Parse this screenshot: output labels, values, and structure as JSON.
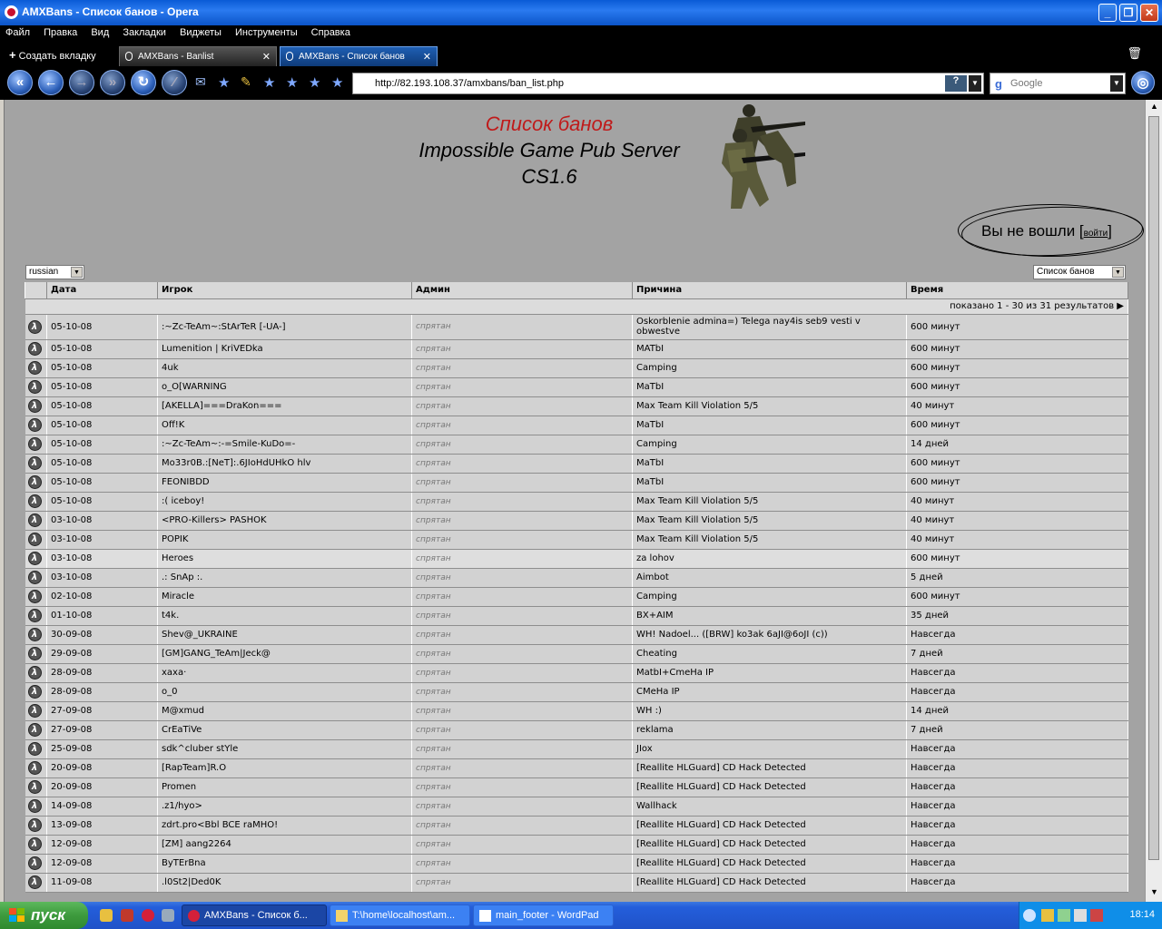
{
  "window": {
    "title": "AMXBans - Список банов - Opera"
  },
  "menu": [
    "Файл",
    "Правка",
    "Вид",
    "Закладки",
    "Виджеты",
    "Инструменты",
    "Справка"
  ],
  "tabs": {
    "new_tab": "Создать вкладку",
    "items": [
      {
        "label": "AMXBans - Banlist",
        "active": false
      },
      {
        "label": "AMXBans - Список банов",
        "active": true
      }
    ]
  },
  "nav": {
    "url": "http://82.193.108.37/amxbans/ban_list.php",
    "search_placeholder": "Google"
  },
  "page": {
    "title_red": "Список банов",
    "title_line2": "Impossible Game Pub Server",
    "title_line3": "CS1.6",
    "login_text": "Вы не вошли",
    "login_link": "войти",
    "language": "russian",
    "view_select": "Список банов",
    "columns": [
      "Дата",
      "Игрок",
      "Админ",
      "Причина",
      "Время"
    ],
    "pager": "показано 1 - 30 из 31 результатов",
    "admin_hidden": "спрятан",
    "rows": [
      {
        "date": "05-10-08",
        "player": ":~Zc-TeAm~:StArTeR [-UA-]",
        "reason": "Oskorblenie admina=) Telega nay4is seb9 vesti v obwestve",
        "time": "600 минут"
      },
      {
        "date": "05-10-08",
        "player": "Lumenition | KriVEDka",
        "reason": "MATbI",
        "time": "600 минут"
      },
      {
        "date": "05-10-08",
        "player": "4uk",
        "reason": "Camping",
        "time": "600 минут"
      },
      {
        "date": "05-10-08",
        "player": "o_O[WARNING",
        "reason": "MaTbI",
        "time": "600 минут"
      },
      {
        "date": "05-10-08",
        "player": "[AKELLA]===DraKon===",
        "reason": "Max Team Kill Violation 5/5",
        "time": "40 минут"
      },
      {
        "date": "05-10-08",
        "player": "Off!K",
        "reason": "MaTbI",
        "time": "600 минут"
      },
      {
        "date": "05-10-08",
        "player": ":~Zc-TeAm~:-=Smile-KuDo=-",
        "reason": "Camping",
        "time": "14 дней"
      },
      {
        "date": "05-10-08",
        "player": "Mo33r0B.:[NeT]:.6JIoHdUHkO hlv",
        "reason": "MaTbI",
        "time": "600 минут"
      },
      {
        "date": "05-10-08",
        "player": "FEONIBDD",
        "reason": "MaTbI",
        "time": "600 минут"
      },
      {
        "date": "05-10-08",
        "player": ":( iceboy!",
        "reason": "Max Team Kill Violation 5/5",
        "time": "40 минут"
      },
      {
        "date": "03-10-08",
        "player": "<PRO-Killers> PASHOK",
        "reason": "Max Team Kill Violation 5/5",
        "time": "40 минут"
      },
      {
        "date": "03-10-08",
        "player": "POPIK",
        "reason": "Max Team Kill Violation 5/5",
        "time": "40 минут"
      },
      {
        "date": "03-10-08",
        "player": "Heroes",
        "reason": "za lohov",
        "time": "600 минут"
      },
      {
        "date": "03-10-08",
        "player": ".: SnAp :.",
        "reason": "Aimbot",
        "time": "5 дней"
      },
      {
        "date": "02-10-08",
        "player": "Miracle",
        "reason": "Camping",
        "time": "600 минут"
      },
      {
        "date": "01-10-08",
        "player": "t4k.",
        "reason": "BX+AIM",
        "time": "35 дней"
      },
      {
        "date": "30-09-08",
        "player": "Shev@_UKRAINE",
        "reason": "WH! Nadoel... ([BRW] ko3ak 6aJI@6oJI (c))",
        "time": "Навсегда"
      },
      {
        "date": "29-09-08",
        "player": "[GM]GANG_TeAm|Jeck@",
        "reason": "Cheating",
        "time": "7 дней"
      },
      {
        "date": "28-09-08",
        "player": "xaxa·",
        "reason": "MatbI+CmeHa IP",
        "time": "Навсегда"
      },
      {
        "date": "28-09-08",
        "player": "o_0",
        "reason": "CMeHa IP",
        "time": "Навсегда"
      },
      {
        "date": "27-09-08",
        "player": "M@xmud",
        "reason": "WH :)",
        "time": "14 дней"
      },
      {
        "date": "27-09-08",
        "player": "CrEaTiVe",
        "reason": "reklama",
        "time": "7 дней"
      },
      {
        "date": "25-09-08",
        "player": "sdk^cluber stYle",
        "reason": "JIox",
        "time": "Навсегда"
      },
      {
        "date": "20-09-08",
        "player": "[RapTeam]R.O",
        "reason": "[Reallite HLGuard] CD Hack Detected",
        "time": "Навсегда"
      },
      {
        "date": "20-09-08",
        "player": "Promen",
        "reason": "[Reallite HLGuard] CD Hack Detected",
        "time": "Навсегда"
      },
      {
        "date": "14-09-08",
        "player": ".z1/hyo>",
        "reason": "Wallhack",
        "time": "Навсегда"
      },
      {
        "date": "13-09-08",
        "player": "zdrt.pro<Bbl BCE raMHO!",
        "reason": "[Reallite HLGuard] CD Hack Detected",
        "time": "Навсегда"
      },
      {
        "date": "12-09-08",
        "player": "[ZM] aang2264",
        "reason": "[Reallite HLGuard] CD Hack Detected",
        "time": "Навсегда"
      },
      {
        "date": "12-09-08",
        "player": "ByTErBna",
        "reason": "[Reallite HLGuard] CD Hack Detected",
        "time": "Навсегда"
      },
      {
        "date": "11-09-08",
        "player": ".l0St2|Ded0K",
        "reason": "[Reallite HLGuard] CD Hack Detected",
        "time": "Навсегда"
      }
    ]
  },
  "taskbar": {
    "start": "пуск",
    "buttons": [
      {
        "label": "AMXBans - Список б...",
        "active": true
      },
      {
        "label": "T:\\home\\localhost\\am...",
        "active": false
      },
      {
        "label": "main_footer - WordPad",
        "active": false
      }
    ],
    "clock": "18:14"
  }
}
